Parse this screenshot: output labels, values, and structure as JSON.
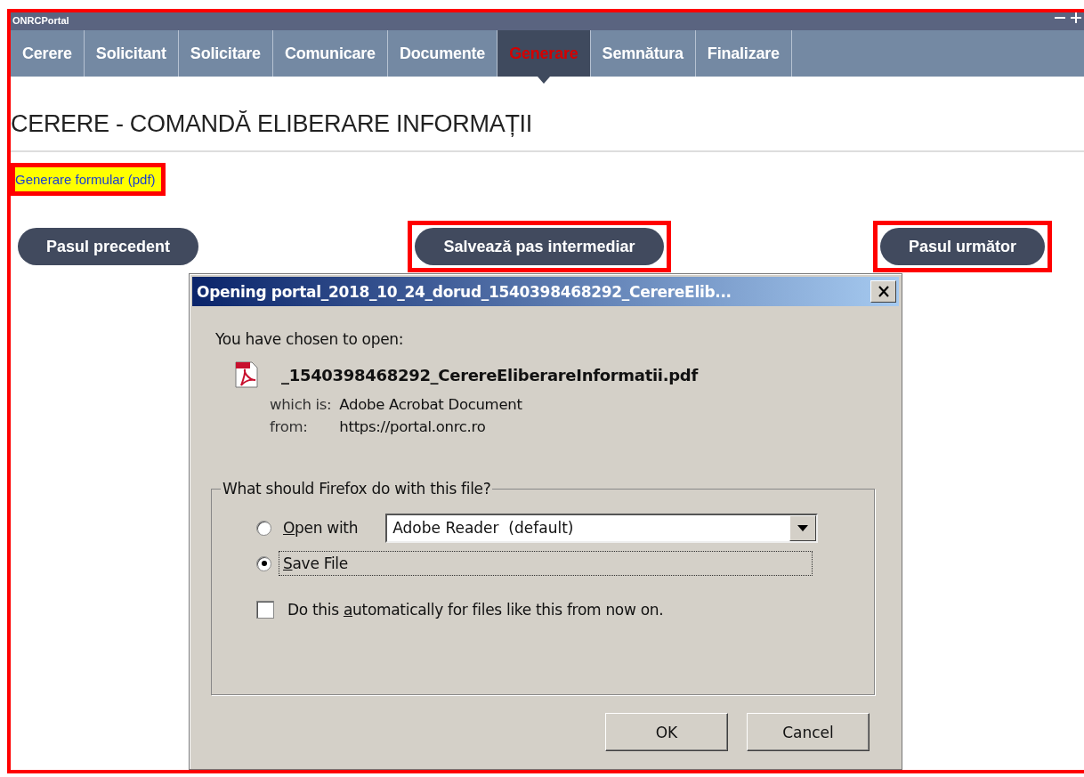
{
  "app": {
    "title": "ONRCPortal"
  },
  "tabs": [
    {
      "label": "Cerere",
      "selected": false
    },
    {
      "label": "Solicitant",
      "selected": false
    },
    {
      "label": "Solicitare",
      "selected": false
    },
    {
      "label": "Comunicare",
      "selected": false
    },
    {
      "label": "Documente",
      "selected": false
    },
    {
      "label": "Generare",
      "selected": true
    },
    {
      "label": "Semnătura",
      "selected": false
    },
    {
      "label": "Finalizare",
      "selected": false
    }
  ],
  "heading": "CERERE - COMANDĂ ELIBERARE INFORMAȚII",
  "link": {
    "text": "Generare formular (pdf)",
    "highlighted": true
  },
  "buttons": [
    {
      "label": "Pasul precedent",
      "highlighted": false
    },
    {
      "label": "Salvează pas intermediar",
      "highlighted": true
    },
    {
      "label": "Pasul următor",
      "highlighted": true
    }
  ],
  "dialog": {
    "title": "Opening portal_2018_10_24_dorud_1540398468292_CerereElib...",
    "intro": "You have chosen to open:",
    "file_name": "_1540398468292_CerereEliberareInformatii.pdf",
    "details": [
      {
        "label": "which is:",
        "value": "Adobe Acrobat Document"
      },
      {
        "label": "from:",
        "value": "https://portal.onrc.ro"
      }
    ],
    "group_title": "What should Firefox do with this file?",
    "options": [
      {
        "access_key": "O",
        "label_after": "pen with",
        "selected": false,
        "focused": false
      },
      {
        "access_key": "S",
        "label_after": "ave File",
        "selected": true,
        "focused": true
      }
    ],
    "open_with_app": "Adobe Reader  (default)",
    "auto": {
      "label_before": "Do this ",
      "access_key": "a",
      "label_after": "utomatically for files like this from now on.",
      "checked": false
    },
    "buttons": [
      "OK",
      "Cancel"
    ]
  }
}
